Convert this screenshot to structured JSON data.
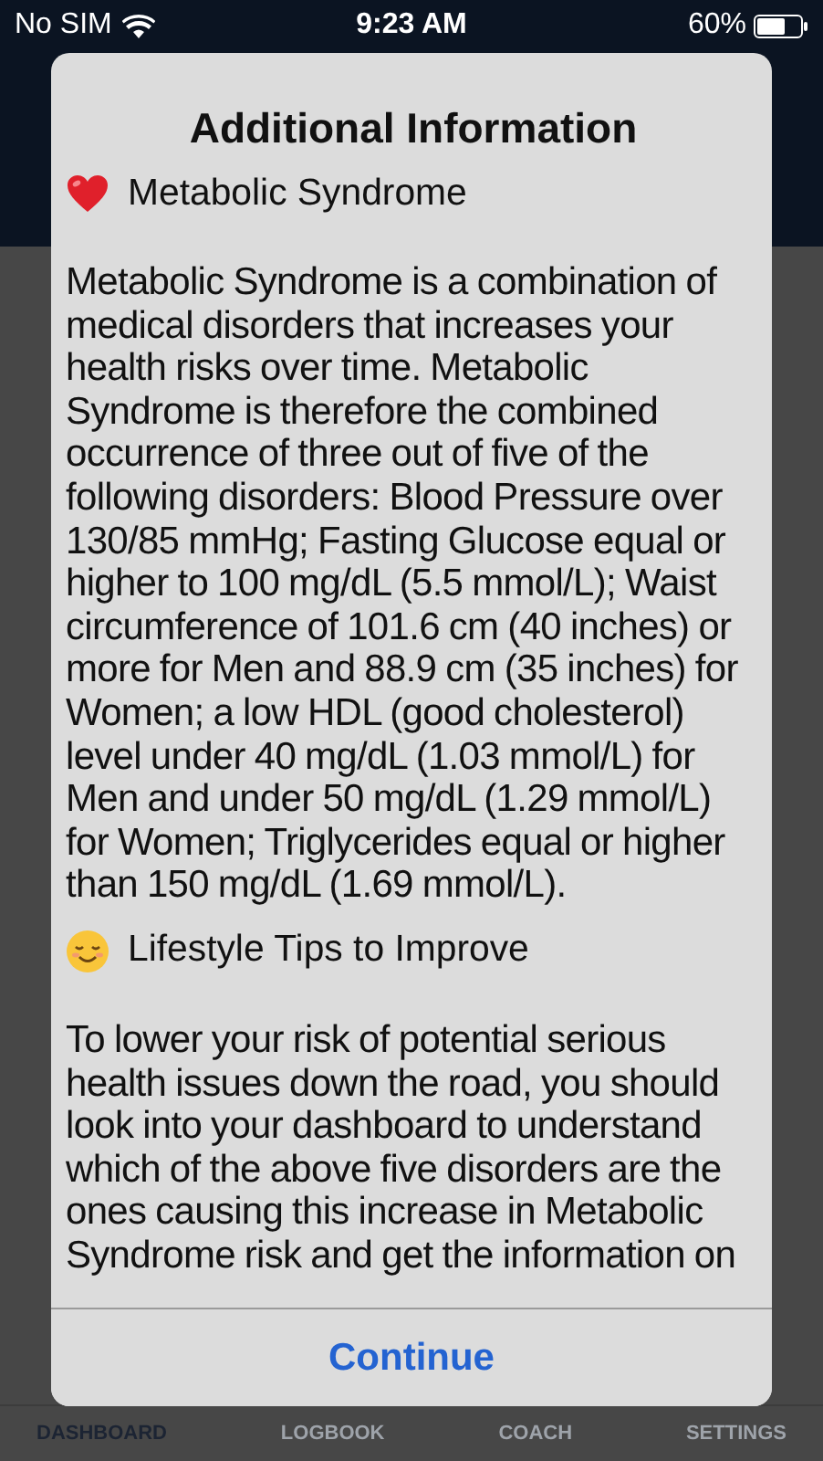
{
  "status_bar": {
    "carrier": "No SIM",
    "time": "9:23 AM",
    "battery": "60%"
  },
  "dialog": {
    "title": "Additional Information",
    "sections": [
      {
        "heading": "Metabolic Syndrome",
        "text": "Metabolic Syndrome is a combination of medical disorders that increases your health risks over time. Metabolic Syndrome is therefore the combined occurrence of three out of five of the following disorders: Blood Pressure over 130/85 mmHg; Fasting Glucose equal or higher to 100 mg/dL (5.5 mmol/L); Waist circumference of 101.6 cm (40 inches) or more for Men and 88.9 cm (35 inches) for Women; a low HDL (good cholesterol) level under 40 mg/dL (1.03 mmol/L) for Men and under 50 mg/dL (1.29 mmol/L) for Women; Triglycerides equal or higher than 150 mg/dL (1.69 mmol/L)."
      },
      {
        "heading": "Lifestyle Tips to Improve",
        "text": "To lower your risk of potential serious health issues down the road, you should look into your dashboard to understand which of the above five disorders are the ones causing this increase in Metabolic Syndrome risk and get the information on"
      }
    ],
    "button": "Continue"
  },
  "tab_bar": [
    {
      "label": "DASHBOARD",
      "selected": true
    },
    {
      "label": "LOGBOOK",
      "selected": false
    },
    {
      "label": "COACH",
      "selected": false
    },
    {
      "label": "SETTINGS",
      "selected": false
    }
  ]
}
